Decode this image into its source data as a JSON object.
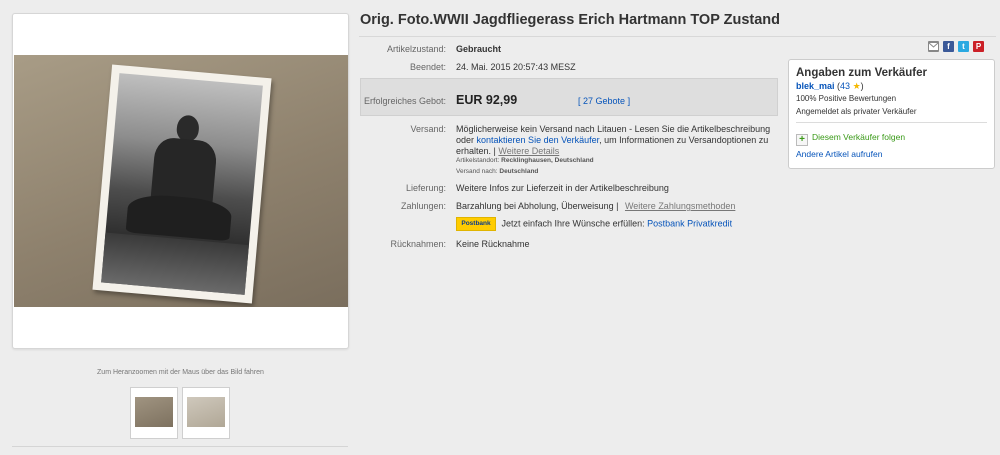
{
  "title": "Orig. Foto.WWII Jagdfliegerass Erich Hartmann TOP Zustand",
  "gallery": {
    "zoom_hint": "Zum Heranzoomen mit der Maus über das Bild fahren",
    "thumbnails": [
      "photo-front",
      "photo-back"
    ]
  },
  "details": {
    "condition_label": "Artikelzustand:",
    "condition_value": "Gebraucht",
    "ended_label": "Beendet:",
    "ended_value": "24. Mai. 2015  20:57:43 MESZ",
    "bid_label": "Erfolgreiches Gebot:",
    "bid_value": "EUR 92,99",
    "bids_count": "27 Gebote",
    "shipping_label": "Versand:",
    "shipping_text_1": "Möglicherweise kein Versand nach Litauen - Lesen Sie die Artikelbeschreibung oder",
    "shipping_contact_link": "kontaktieren Sie den Verkäufer",
    "shipping_text_2": ", um Informationen zu Versandoptionen zu erhalten.  |",
    "shipping_more_link": "Weitere Details",
    "location_label": "Artikelstandort:",
    "location_value": "Recklinghausen, Deutschland",
    "ships_to_label": "Versand nach:",
    "ships_to_value": "Deutschland",
    "delivery_label": "Lieferung:",
    "delivery_value": "Weitere Infos zur Lieferzeit in der Artikelbeschreibung",
    "payment_label": "Zahlungen:",
    "payment_value": "Barzahlung bei Abholung,  Überweisung  |",
    "payment_more_link": "Weitere Zahlungsmethoden",
    "postbank_logo": "Postbank",
    "postbank_text": "Jetzt einfach Ihre Wünsche erfüllen:",
    "postbank_link": "Postbank Privatkredit",
    "returns_label": "Rücknahmen:",
    "returns_value": "Keine Rücknahme"
  },
  "share": {
    "icons": [
      "email-icon",
      "facebook-icon",
      "twitter-icon",
      "pinterest-icon"
    ],
    "facebook_glyph": "f",
    "twitter_glyph": "t",
    "pinterest_glyph": "P"
  },
  "seller": {
    "heading": "Angaben zum Verkäufer",
    "name": "blek_mai",
    "rating_open": "(",
    "rating_count": "43",
    "rating_close": ")",
    "star_glyph": "★",
    "positive": "100% Positive Bewertungen",
    "registered": "Angemeldet als privater Verkäufer",
    "follow_plus": "+",
    "follow": "Diesem Verkäufer folgen",
    "other_items": "Andere Artikel aufrufen"
  },
  "colors": {
    "link": "#0654ba",
    "price_box": "#dedede",
    "facebook": "#3b5998",
    "twitter": "#2ba9e1",
    "pinterest": "#cb2027",
    "follow_green": "#3a9a18",
    "star": "#f5b800"
  }
}
